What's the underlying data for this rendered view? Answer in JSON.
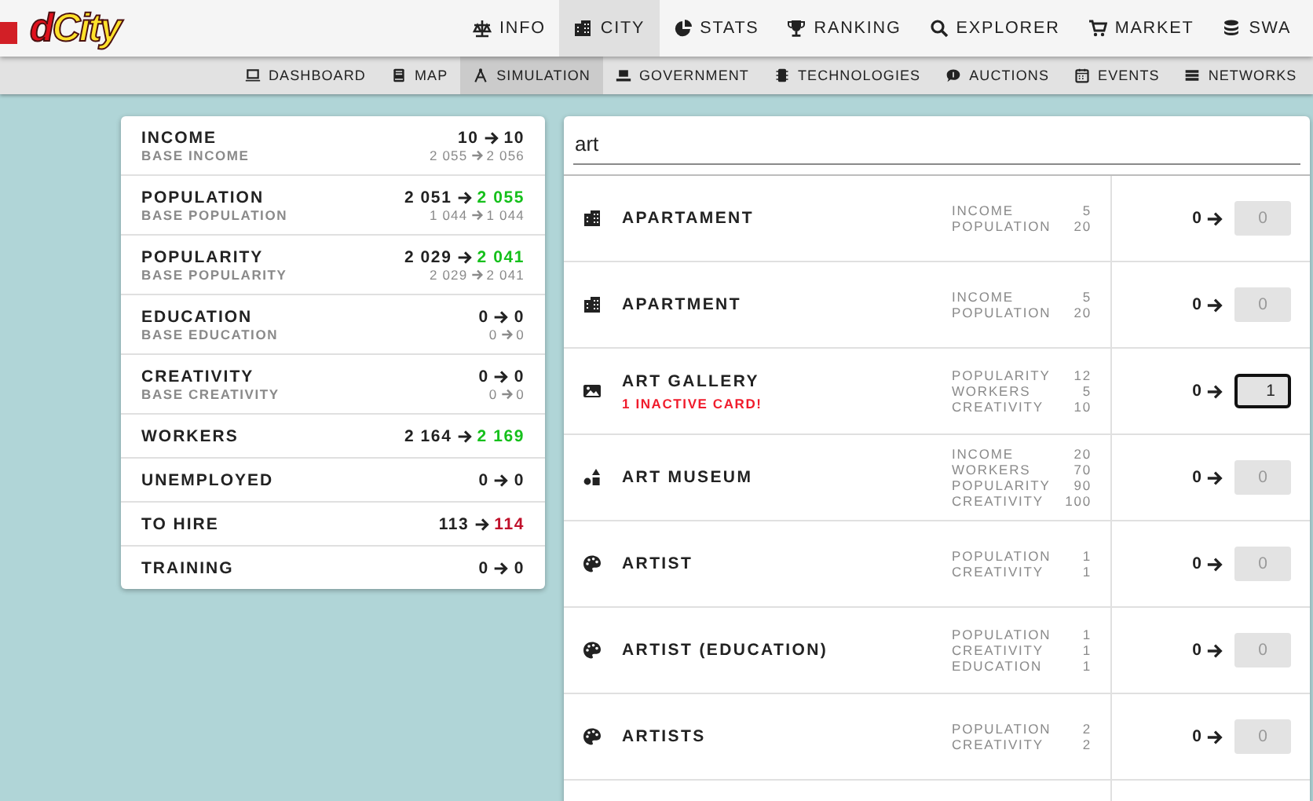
{
  "header": {
    "logo": "dCity",
    "nav": [
      {
        "label": "INFO",
        "selected": false
      },
      {
        "label": "CITY",
        "selected": true
      },
      {
        "label": "STATS",
        "selected": false
      },
      {
        "label": "RANKING",
        "selected": false
      },
      {
        "label": "EXPLORER",
        "selected": false
      },
      {
        "label": "MARKET",
        "selected": false
      },
      {
        "label": "SWA",
        "selected": false
      }
    ],
    "subnav": [
      {
        "label": "DASHBOARD",
        "selected": false
      },
      {
        "label": "MAP",
        "selected": false
      },
      {
        "label": "SIMULATION",
        "selected": true
      },
      {
        "label": "GOVERNMENT",
        "selected": false
      },
      {
        "label": "TECHNOLOGIES",
        "selected": false
      },
      {
        "label": "AUCTIONS",
        "selected": false
      },
      {
        "label": "EVENTS",
        "selected": false
      },
      {
        "label": "NETWORKS",
        "selected": false
      }
    ]
  },
  "summary": [
    {
      "label": "INCOME",
      "from": "10",
      "to": "10",
      "color": "#222222",
      "base_label": "BASE INCOME",
      "base_from": "2 055",
      "base_to": "2 056"
    },
    {
      "label": "POPULATION",
      "from": "2 051",
      "to": "2 055",
      "color": "#16c01c",
      "base_label": "BASE POPULATION",
      "base_from": "1 044",
      "base_to": "1 044"
    },
    {
      "label": "POPULARITY",
      "from": "2 029",
      "to": "2 041",
      "color": "#16c01c",
      "base_label": "BASE POPULARITY",
      "base_from": "2 029",
      "base_to": "2 041"
    },
    {
      "label": "EDUCATION",
      "from": "0",
      "to": "0",
      "color": "#222222",
      "base_label": "BASE EDUCATION",
      "base_from": "0",
      "base_to": "0"
    },
    {
      "label": "CREATIVITY",
      "from": "0",
      "to": "0",
      "color": "#222222",
      "base_label": "BASE CREATIVITY",
      "base_from": "0",
      "base_to": "0"
    },
    {
      "label": "WORKERS",
      "from": "2 164",
      "to": "2 169",
      "color": "#16c01c"
    },
    {
      "label": "UNEMPLOYED",
      "from": "0",
      "to": "0",
      "color": "#222222"
    },
    {
      "label": "TO HIRE",
      "from": "113",
      "to": "114",
      "color": "#c0112b"
    },
    {
      "label": "TRAINING",
      "from": "0",
      "to": "0",
      "color": "#222222"
    }
  ],
  "search": {
    "value": "art"
  },
  "buildings": [
    {
      "name": "APARTAMENT",
      "stats": [
        {
          "label": "INCOME",
          "value": "5"
        },
        {
          "label": "POPULATION",
          "value": "20"
        }
      ],
      "count": "0",
      "amount": "0",
      "focused": false
    },
    {
      "name": "APARTMENT",
      "stats": [
        {
          "label": "INCOME",
          "value": "5"
        },
        {
          "label": "POPULATION",
          "value": "20"
        }
      ],
      "count": "0",
      "amount": "0",
      "focused": false
    },
    {
      "name": "ART GALLERY",
      "warning": "1 INACTIVE CARD!",
      "stats": [
        {
          "label": "POPULARITY",
          "value": "12"
        },
        {
          "label": "WORKERS",
          "value": "5"
        },
        {
          "label": "CREATIVITY",
          "value": "10"
        }
      ],
      "count": "0",
      "amount": "1",
      "focused": true
    },
    {
      "name": "ART MUSEUM",
      "stats": [
        {
          "label": "INCOME",
          "value": "20"
        },
        {
          "label": "WORKERS",
          "value": "70"
        },
        {
          "label": "POPULARITY",
          "value": "90"
        },
        {
          "label": "CREATIVITY",
          "value": "100"
        }
      ],
      "count": "0",
      "amount": "0",
      "focused": false
    },
    {
      "name": "ARTIST",
      "stats": [
        {
          "label": "POPULATION",
          "value": "1"
        },
        {
          "label": "CREATIVITY",
          "value": "1"
        }
      ],
      "count": "0",
      "amount": "0",
      "focused": false
    },
    {
      "name": "ARTIST (EDUCATION)",
      "stats": [
        {
          "label": "POPULATION",
          "value": "1"
        },
        {
          "label": "CREATIVITY",
          "value": "1"
        },
        {
          "label": "EDUCATION",
          "value": "1"
        }
      ],
      "count": "0",
      "amount": "0",
      "focused": false
    },
    {
      "name": "ARTISTS",
      "stats": [
        {
          "label": "POPULATION",
          "value": "2"
        },
        {
          "label": "CREATIVITY",
          "value": "2"
        }
      ],
      "count": "0",
      "amount": "0",
      "focused": false
    }
  ]
}
